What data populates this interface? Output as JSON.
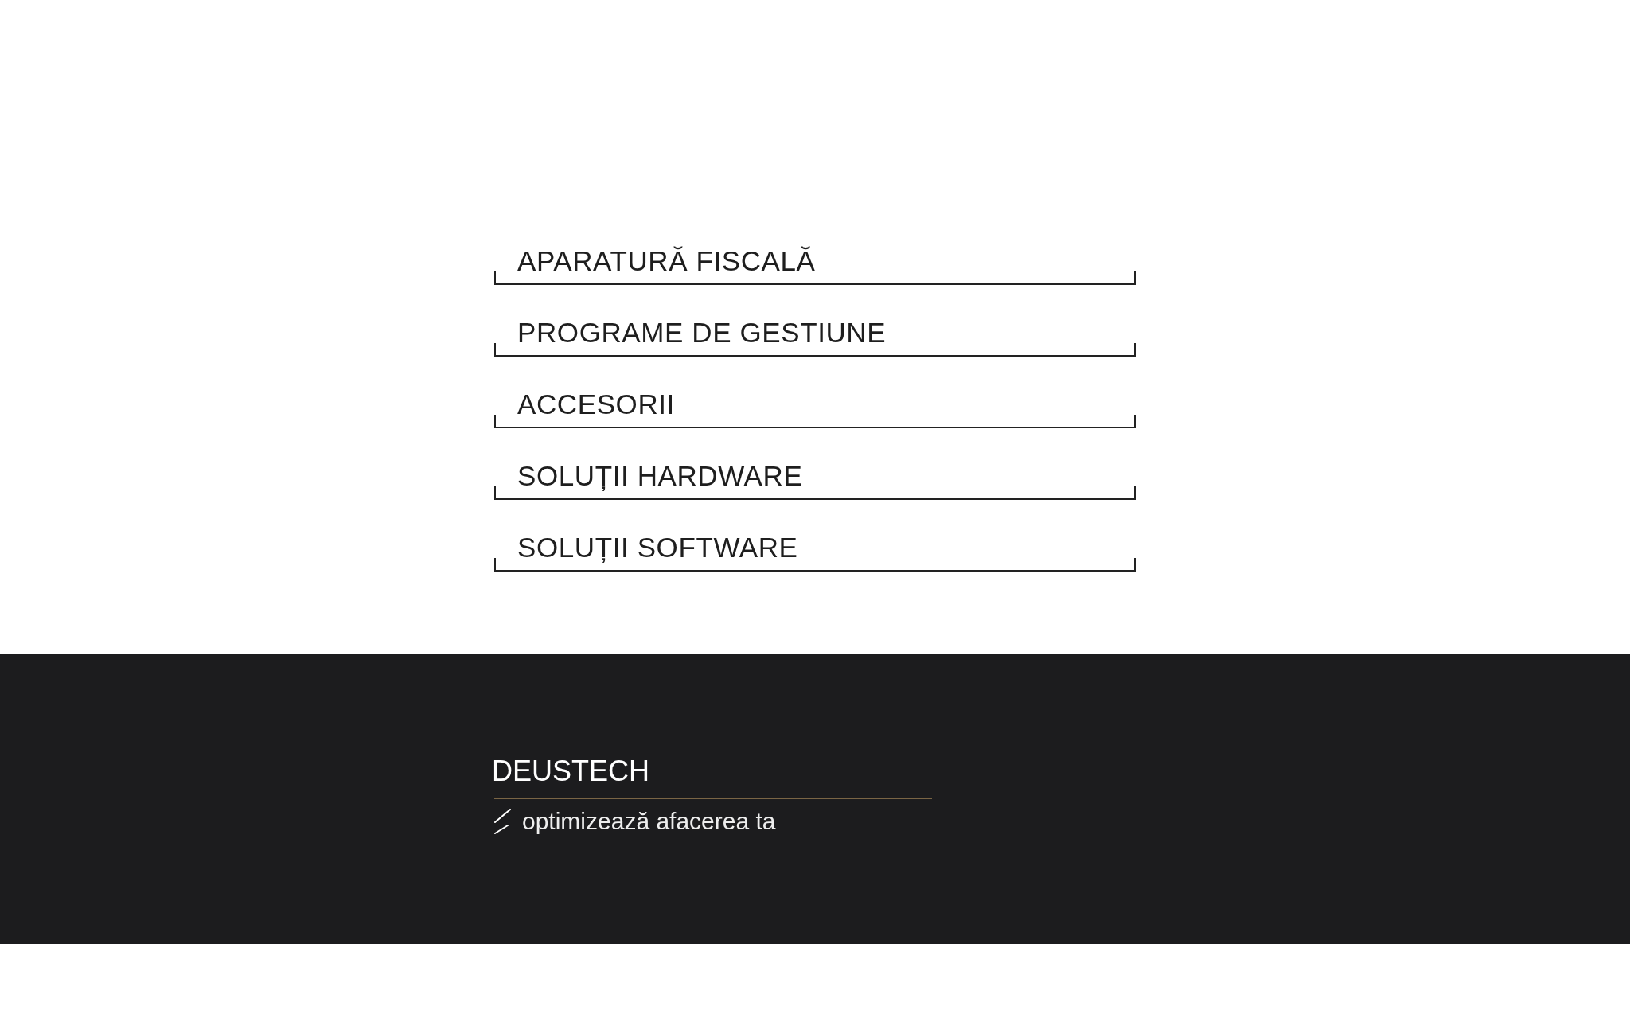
{
  "menu": {
    "items": [
      {
        "label": "APARATURĂ FISCALĂ"
      },
      {
        "label": "PROGRAME DE GESTIUNE"
      },
      {
        "label": "ACCESORII"
      },
      {
        "label": "SOLUȚII HARDWARE"
      },
      {
        "label": "SOLUȚII SOFTWARE"
      }
    ]
  },
  "footer": {
    "brand": "DEUSTECH",
    "tagline": "optimizează afacerea ta"
  }
}
